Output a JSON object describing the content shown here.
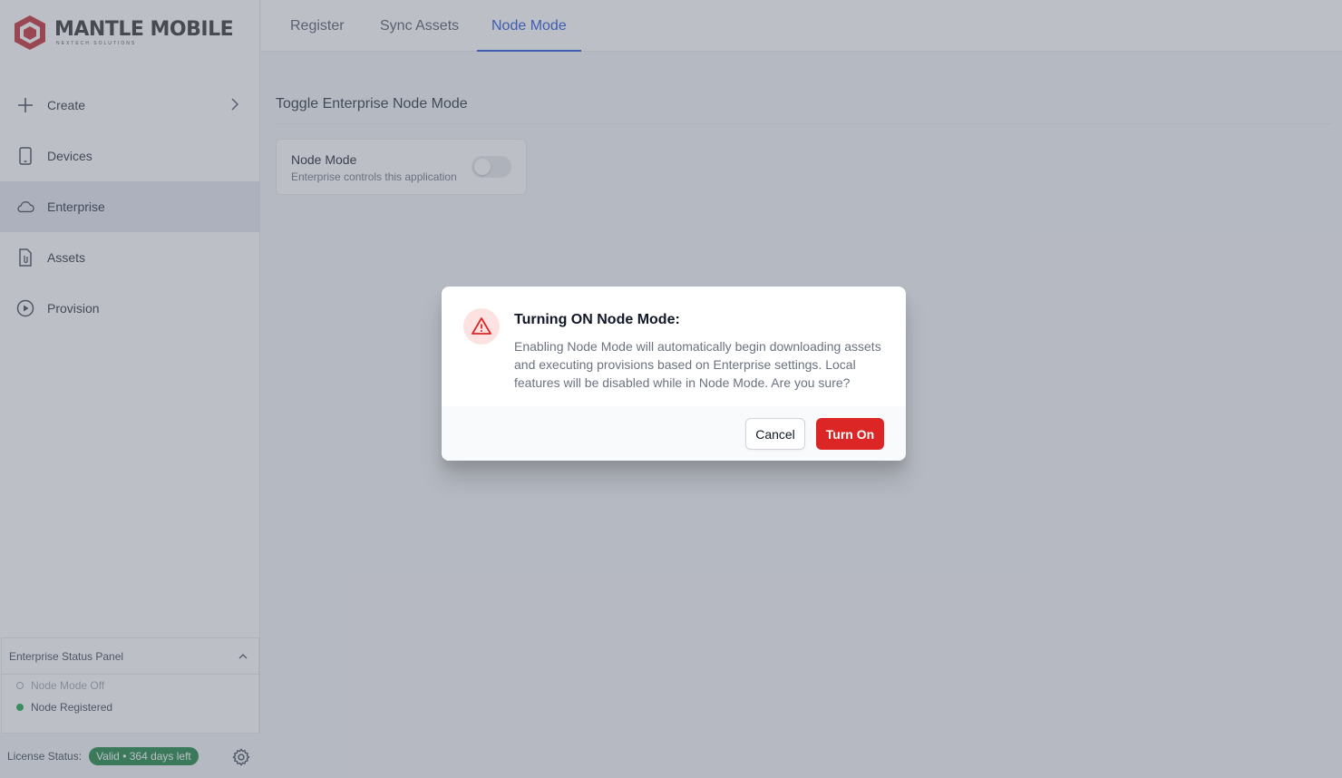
{
  "app": {
    "brand": "MANTLE MOBILE",
    "brand_tagline": "NEXTECH SOLUTIONS"
  },
  "sidebar": {
    "items": [
      {
        "label": "Create",
        "icon": "plus-icon"
      },
      {
        "label": "Devices",
        "icon": "phone-icon"
      },
      {
        "label": "Enterprise",
        "icon": "cloud-icon"
      },
      {
        "label": "Assets",
        "icon": "document-icon"
      },
      {
        "label": "Provision",
        "icon": "play-circle-icon"
      }
    ],
    "status_panel": {
      "title": "Enterprise Status Panel",
      "rows": [
        "Node Mode Off",
        "Node Registered"
      ]
    },
    "license": {
      "label": "License Status:",
      "badge": "Valid • 364 days left"
    }
  },
  "tabs": [
    "Register",
    "Sync Assets",
    "Node Mode"
  ],
  "main": {
    "section_title": "Toggle Enterprise Node Mode",
    "card": {
      "title": "Node Mode",
      "subtitle": "Enterprise controls this application",
      "toggle_on": false
    }
  },
  "modal": {
    "title": "Turning ON Node Mode:",
    "body": "Enabling Node Mode will automatically begin downloading assets and executing provisions based on Enterprise settings. Local features will be disabled while in Node Mode. Are you sure?",
    "cancel_label": "Cancel",
    "confirm_label": "Turn On"
  },
  "colors": {
    "accent": "#1d4ed8",
    "danger": "#dc2626",
    "success": "#15803d",
    "active_nav": "#e3e6f1"
  }
}
